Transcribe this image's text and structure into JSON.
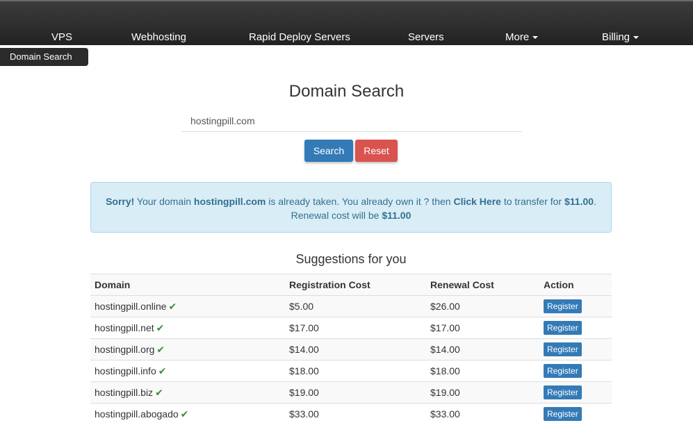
{
  "nav": {
    "items": [
      {
        "label": "VPS",
        "dropdown": false
      },
      {
        "label": "Webhosting",
        "dropdown": false
      },
      {
        "label": "Rapid Deploy Servers",
        "dropdown": false
      },
      {
        "label": "Servers",
        "dropdown": false
      },
      {
        "label": "More",
        "dropdown": true
      },
      {
        "label": "Billing",
        "dropdown": true
      }
    ]
  },
  "breadcrumb": {
    "label": "Domain Search"
  },
  "page": {
    "title": "Domain Search"
  },
  "search": {
    "value": "hostingpill.com",
    "search_label": "Search",
    "reset_label": "Reset"
  },
  "alert": {
    "sorry": "Sorry!",
    "text1": " Your domain ",
    "domain": "hostingpill.com",
    "text2": " is already taken. You already own it ? then ",
    "link": "Click Here",
    "text3": " to transfer for ",
    "transfer_price": "$11.00",
    "text4": ".",
    "renewal_text": "Renewal cost will be ",
    "renewal_price": "$11.00"
  },
  "suggestions": {
    "title": "Suggestions for you",
    "headers": [
      "Domain",
      "Registration Cost",
      "Renewal Cost",
      "Action"
    ],
    "action_label": "Register",
    "rows": [
      {
        "domain": "hostingpill.online",
        "registration": "$5.00",
        "renewal": "$26.00"
      },
      {
        "domain": "hostingpill.net",
        "registration": "$17.00",
        "renewal": "$17.00"
      },
      {
        "domain": "hostingpill.org",
        "registration": "$14.00",
        "renewal": "$14.00"
      },
      {
        "domain": "hostingpill.info",
        "registration": "$18.00",
        "renewal": "$18.00"
      },
      {
        "domain": "hostingpill.biz",
        "registration": "$19.00",
        "renewal": "$19.00"
      },
      {
        "domain": "hostingpill.abogado",
        "registration": "$33.00",
        "renewal": "$33.00"
      }
    ]
  },
  "icons": {
    "available": "check-icon",
    "dropdown": "caret-down-icon"
  },
  "colors": {
    "primary": "#337ab7",
    "danger": "#d9534f",
    "info_bg": "#d9edf7",
    "info_text": "#31708f",
    "success_check": "#3c8b3c",
    "navbar": "#2b2b2b"
  }
}
